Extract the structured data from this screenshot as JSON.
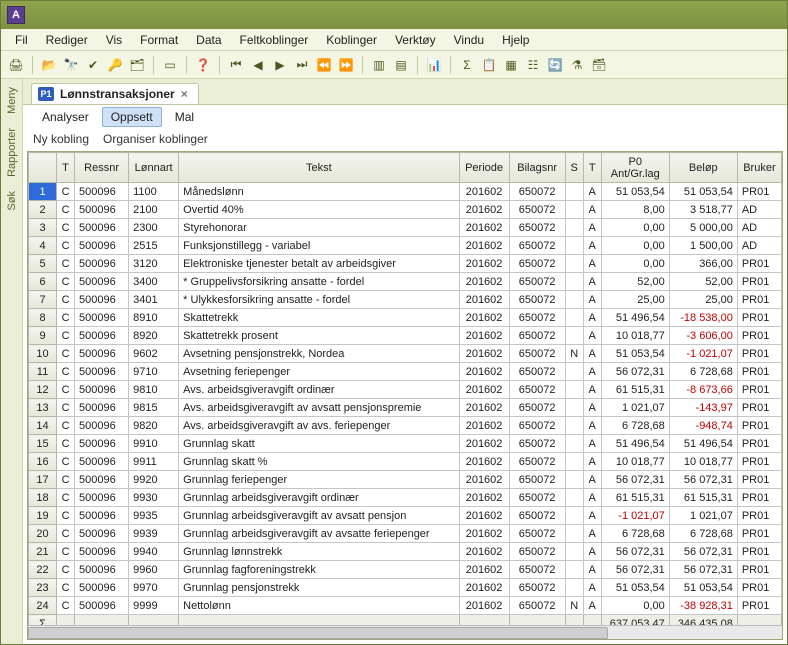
{
  "app": {
    "icon_letter": "A"
  },
  "menu": [
    "Fil",
    "Rediger",
    "Vis",
    "Format",
    "Data",
    "Feltkoblinger",
    "Koblinger",
    "Verktøy",
    "Vindu",
    "Hjelp"
  ],
  "sidetabs": [
    "Meny",
    "Rapporter",
    "Søk"
  ],
  "toolbar_icons": [
    "print-icon",
    "sep",
    "open-icon",
    "binoculars-icon",
    "check-icon",
    "magnifier-icon",
    "hierarchy-icon",
    "sep",
    "ab-icon",
    "sep",
    "help-icon",
    "sep",
    "first-icon",
    "prev-icon",
    "play-icon",
    "last-icon",
    "step-back-icon",
    "step-fwd-icon",
    "sep",
    "panel1-icon",
    "panel2-icon",
    "sep",
    "chart-icon",
    "sep",
    "sigma-icon",
    "copy-icon",
    "table-icon",
    "columns-icon",
    "refresh-icon",
    "filter-icon",
    "db-icon"
  ],
  "tab": {
    "icon": "P1",
    "title": "Lønnstransaksjoner",
    "closable": true
  },
  "subtabs": [
    {
      "label": "Analyser",
      "active": false
    },
    {
      "label": "Oppsett",
      "active": true
    },
    {
      "label": "Mal",
      "active": false
    }
  ],
  "links": [
    "Ny kobling",
    "Organiser koblinger"
  ],
  "columns": [
    "",
    "T",
    "Ressnr",
    "Lønnart",
    "Tekst",
    "Periode",
    "Bilagsnr",
    "S",
    "T",
    "P0\nAnt/Gr.lag",
    "Beløp",
    "Bruker"
  ],
  "rows": [
    {
      "n": 1,
      "t": "C",
      "res": "500096",
      "la": "1100",
      "txt": "Månedslønn",
      "per": "201602",
      "bil": "650072",
      "s": "",
      "t2": "A",
      "p0": "51 053,54",
      "bel": "51 053,54",
      "brk": "PR01",
      "sel": true
    },
    {
      "n": 2,
      "t": "C",
      "res": "500096",
      "la": "2100",
      "txt": "Overtid 40%",
      "per": "201602",
      "bil": "650072",
      "s": "",
      "t2": "A",
      "p0": "8,00",
      "bel": "3 518,77",
      "brk": "AD"
    },
    {
      "n": 3,
      "t": "C",
      "res": "500096",
      "la": "2300",
      "txt": "Styrehonorar",
      "per": "201602",
      "bil": "650072",
      "s": "",
      "t2": "A",
      "p0": "0,00",
      "bel": "5 000,00",
      "brk": "AD"
    },
    {
      "n": 4,
      "t": "C",
      "res": "500096",
      "la": "2515",
      "txt": "Funksjonstillegg - variabel",
      "per": "201602",
      "bil": "650072",
      "s": "",
      "t2": "A",
      "p0": "0,00",
      "bel": "1 500,00",
      "brk": "AD"
    },
    {
      "n": 5,
      "t": "C",
      "res": "500096",
      "la": "3120",
      "txt": "Elektroniske tjenester betalt av arbeidsgiver",
      "per": "201602",
      "bil": "650072",
      "s": "",
      "t2": "A",
      "p0": "0,00",
      "bel": "366,00",
      "brk": "PR01"
    },
    {
      "n": 6,
      "t": "C",
      "res": "500096",
      "la": "3400",
      "txt": "* Gruppelivsforsikring ansatte - fordel",
      "per": "201602",
      "bil": "650072",
      "s": "",
      "t2": "A",
      "p0": "52,00",
      "bel": "52,00",
      "brk": "PR01"
    },
    {
      "n": 7,
      "t": "C",
      "res": "500096",
      "la": "3401",
      "txt": "* Ulykkesforsikring ansatte - fordel",
      "per": "201602",
      "bil": "650072",
      "s": "",
      "t2": "A",
      "p0": "25,00",
      "bel": "25,00",
      "brk": "PR01"
    },
    {
      "n": 8,
      "t": "C",
      "res": "500096",
      "la": "8910",
      "txt": "Skattetrekk",
      "per": "201602",
      "bil": "650072",
      "s": "",
      "t2": "A",
      "p0": "51 496,54",
      "bel": "-18 538,00",
      "brk": "PR01",
      "neg": true
    },
    {
      "n": 9,
      "t": "C",
      "res": "500096",
      "la": "8920",
      "txt": "Skattetrekk prosent",
      "per": "201602",
      "bil": "650072",
      "s": "",
      "t2": "A",
      "p0": "10 018,77",
      "bel": "-3 606,00",
      "brk": "PR01",
      "neg": true
    },
    {
      "n": 10,
      "t": "C",
      "res": "500096",
      "la": "9602",
      "txt": "Avsetning pensjonstrekk, Nordea",
      "per": "201602",
      "bil": "650072",
      "s": "N",
      "t2": "A",
      "p0": "51 053,54",
      "bel": "-1 021,07",
      "brk": "PR01",
      "neg": true
    },
    {
      "n": 11,
      "t": "C",
      "res": "500096",
      "la": "9710",
      "txt": "Avsetning feriepenger",
      "per": "201602",
      "bil": "650072",
      "s": "",
      "t2": "A",
      "p0": "56 072,31",
      "bel": "6 728,68",
      "brk": "PR01"
    },
    {
      "n": 12,
      "t": "C",
      "res": "500096",
      "la": "9810",
      "txt": "Avs. arbeidsgiveravgift ordinær",
      "per": "201602",
      "bil": "650072",
      "s": "",
      "t2": "A",
      "p0": "61 515,31",
      "bel": "-8 673,66",
      "brk": "PR01",
      "neg": true
    },
    {
      "n": 13,
      "t": "C",
      "res": "500096",
      "la": "9815",
      "txt": "Avs. arbeidsgiveravgift av avsatt pensjonspremie",
      "per": "201602",
      "bil": "650072",
      "s": "",
      "t2": "A",
      "p0": "1 021,07",
      "bel": "-143,97",
      "brk": "PR01",
      "neg": true
    },
    {
      "n": 14,
      "t": "C",
      "res": "500096",
      "la": "9820",
      "txt": "Avs. arbeidsgiveravgift av avs. feriepenger",
      "per": "201602",
      "bil": "650072",
      "s": "",
      "t2": "A",
      "p0": "6 728,68",
      "bel": "-948,74",
      "brk": "PR01",
      "neg": true
    },
    {
      "n": 15,
      "t": "C",
      "res": "500096",
      "la": "9910",
      "txt": "Grunnlag skatt",
      "per": "201602",
      "bil": "650072",
      "s": "",
      "t2": "A",
      "p0": "51 496,54",
      "bel": "51 496,54",
      "brk": "PR01"
    },
    {
      "n": 16,
      "t": "C",
      "res": "500096",
      "la": "9911",
      "txt": "Grunnlag skatt %",
      "per": "201602",
      "bil": "650072",
      "s": "",
      "t2": "A",
      "p0": "10 018,77",
      "bel": "10 018,77",
      "brk": "PR01"
    },
    {
      "n": 17,
      "t": "C",
      "res": "500096",
      "la": "9920",
      "txt": "Grunnlag feriepenger",
      "per": "201602",
      "bil": "650072",
      "s": "",
      "t2": "A",
      "p0": "56 072,31",
      "bel": "56 072,31",
      "brk": "PR01"
    },
    {
      "n": 18,
      "t": "C",
      "res": "500096",
      "la": "9930",
      "txt": "Grunnlag arbeidsgiveravgift ordinær",
      "per": "201602",
      "bil": "650072",
      "s": "",
      "t2": "A",
      "p0": "61 515,31",
      "bel": "61 515,31",
      "brk": "PR01"
    },
    {
      "n": 19,
      "t": "C",
      "res": "500096",
      "la": "9935",
      "txt": "Grunnlag arbeidsgiveravgift av avsatt pensjon",
      "per": "201602",
      "bil": "650072",
      "s": "",
      "t2": "A",
      "p0": "-1 021,07",
      "bel": "1 021,07",
      "brk": "PR01",
      "p0neg": true
    },
    {
      "n": 20,
      "t": "C",
      "res": "500096",
      "la": "9939",
      "txt": "Grunnlag arbeidsgiveravgift av avsatte feriepenger",
      "per": "201602",
      "bil": "650072",
      "s": "",
      "t2": "A",
      "p0": "6 728,68",
      "bel": "6 728,68",
      "brk": "PR01"
    },
    {
      "n": 21,
      "t": "C",
      "res": "500096",
      "la": "9940",
      "txt": "Grunnlag lønnstrekk",
      "per": "201602",
      "bil": "650072",
      "s": "",
      "t2": "A",
      "p0": "56 072,31",
      "bel": "56 072,31",
      "brk": "PR01"
    },
    {
      "n": 22,
      "t": "C",
      "res": "500096",
      "la": "9960",
      "txt": "Grunnlag fagforeningstrekk",
      "per": "201602",
      "bil": "650072",
      "s": "",
      "t2": "A",
      "p0": "56 072,31",
      "bel": "56 072,31",
      "brk": "PR01"
    },
    {
      "n": 23,
      "t": "C",
      "res": "500096",
      "la": "9970",
      "txt": "Grunnlag pensjonstrekk",
      "per": "201602",
      "bil": "650072",
      "s": "",
      "t2": "A",
      "p0": "51 053,54",
      "bel": "51 053,54",
      "brk": "PR01"
    },
    {
      "n": 24,
      "t": "C",
      "res": "500096",
      "la": "9999",
      "txt": "Nettolønn",
      "per": "201602",
      "bil": "650072",
      "s": "N",
      "t2": "A",
      "p0": "0,00",
      "bel": "-38 928,31",
      "brk": "PR01",
      "neg": true
    }
  ],
  "footer": {
    "sigma": "Σ",
    "p0": "637 053,47",
    "bel": "346 435,08"
  },
  "glyphs": {
    "print-icon": "🖨",
    "open-icon": "📂",
    "binoculars-icon": "🔭",
    "check-icon": "✔",
    "magnifier-icon": "🔑",
    "hierarchy-icon": "🗂",
    "ab-icon": "▭",
    "help-icon": "❓",
    "first-icon": "⏮",
    "prev-icon": "◀",
    "play-icon": "▶",
    "last-icon": "⏭",
    "step-back-icon": "⏪",
    "step-fwd-icon": "⏩",
    "panel1-icon": "▥",
    "panel2-icon": "▤",
    "chart-icon": "📊",
    "sigma-icon": "Σ",
    "copy-icon": "📋",
    "table-icon": "▦",
    "columns-icon": "☷",
    "refresh-icon": "🔄",
    "filter-icon": "⚗",
    "db-icon": "🗃"
  }
}
